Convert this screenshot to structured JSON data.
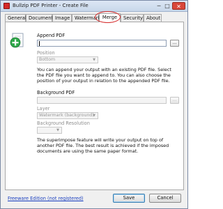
{
  "window": {
    "title": "Bullzip PDF Printer - Create File",
    "minimize_glyph": "─",
    "maximize_glyph": "□",
    "close_glyph": "✕"
  },
  "tabs": [
    {
      "label": "General",
      "active": false
    },
    {
      "label": "Document",
      "active": false
    },
    {
      "label": "Image",
      "active": false
    },
    {
      "label": "Watermark",
      "active": false
    },
    {
      "label": "Merge",
      "active": true
    },
    {
      "label": "Security",
      "active": false
    },
    {
      "label": "About",
      "active": false
    }
  ],
  "annotation": {
    "color": "#d42a2a"
  },
  "append": {
    "label": "Append PDF",
    "file_value": "",
    "browse_label": "...",
    "position_label": "Position",
    "position_value": "Bottom",
    "description": "You can append your output with an existing PDF file. Select the PDF file you want to append to. You can also choose the position of your output in relation to the appended PDF file."
  },
  "background": {
    "label": "Background PDF",
    "file_value": "",
    "browse_label": "...",
    "layer_label": "Layer",
    "layer_value": "Watermark (background)",
    "resolution_label": "Background Resolution",
    "resolution_value": "",
    "description": "The superimpose feature will write your output on top of another PDF file. The best result is achieved if the imposed documents are using the same paper format."
  },
  "footer": {
    "edition_link": "Freeware Edition (not registered)",
    "save_label": "Save",
    "cancel_label": "Cancel"
  },
  "colors": {
    "accent_link": "#1a3fbf",
    "plus_icon_green": "#2fa84a",
    "close_button": "#d9473a"
  },
  "icons": [
    "app-icon",
    "plus-document-icon",
    "dropdown-arrow-icon"
  ]
}
